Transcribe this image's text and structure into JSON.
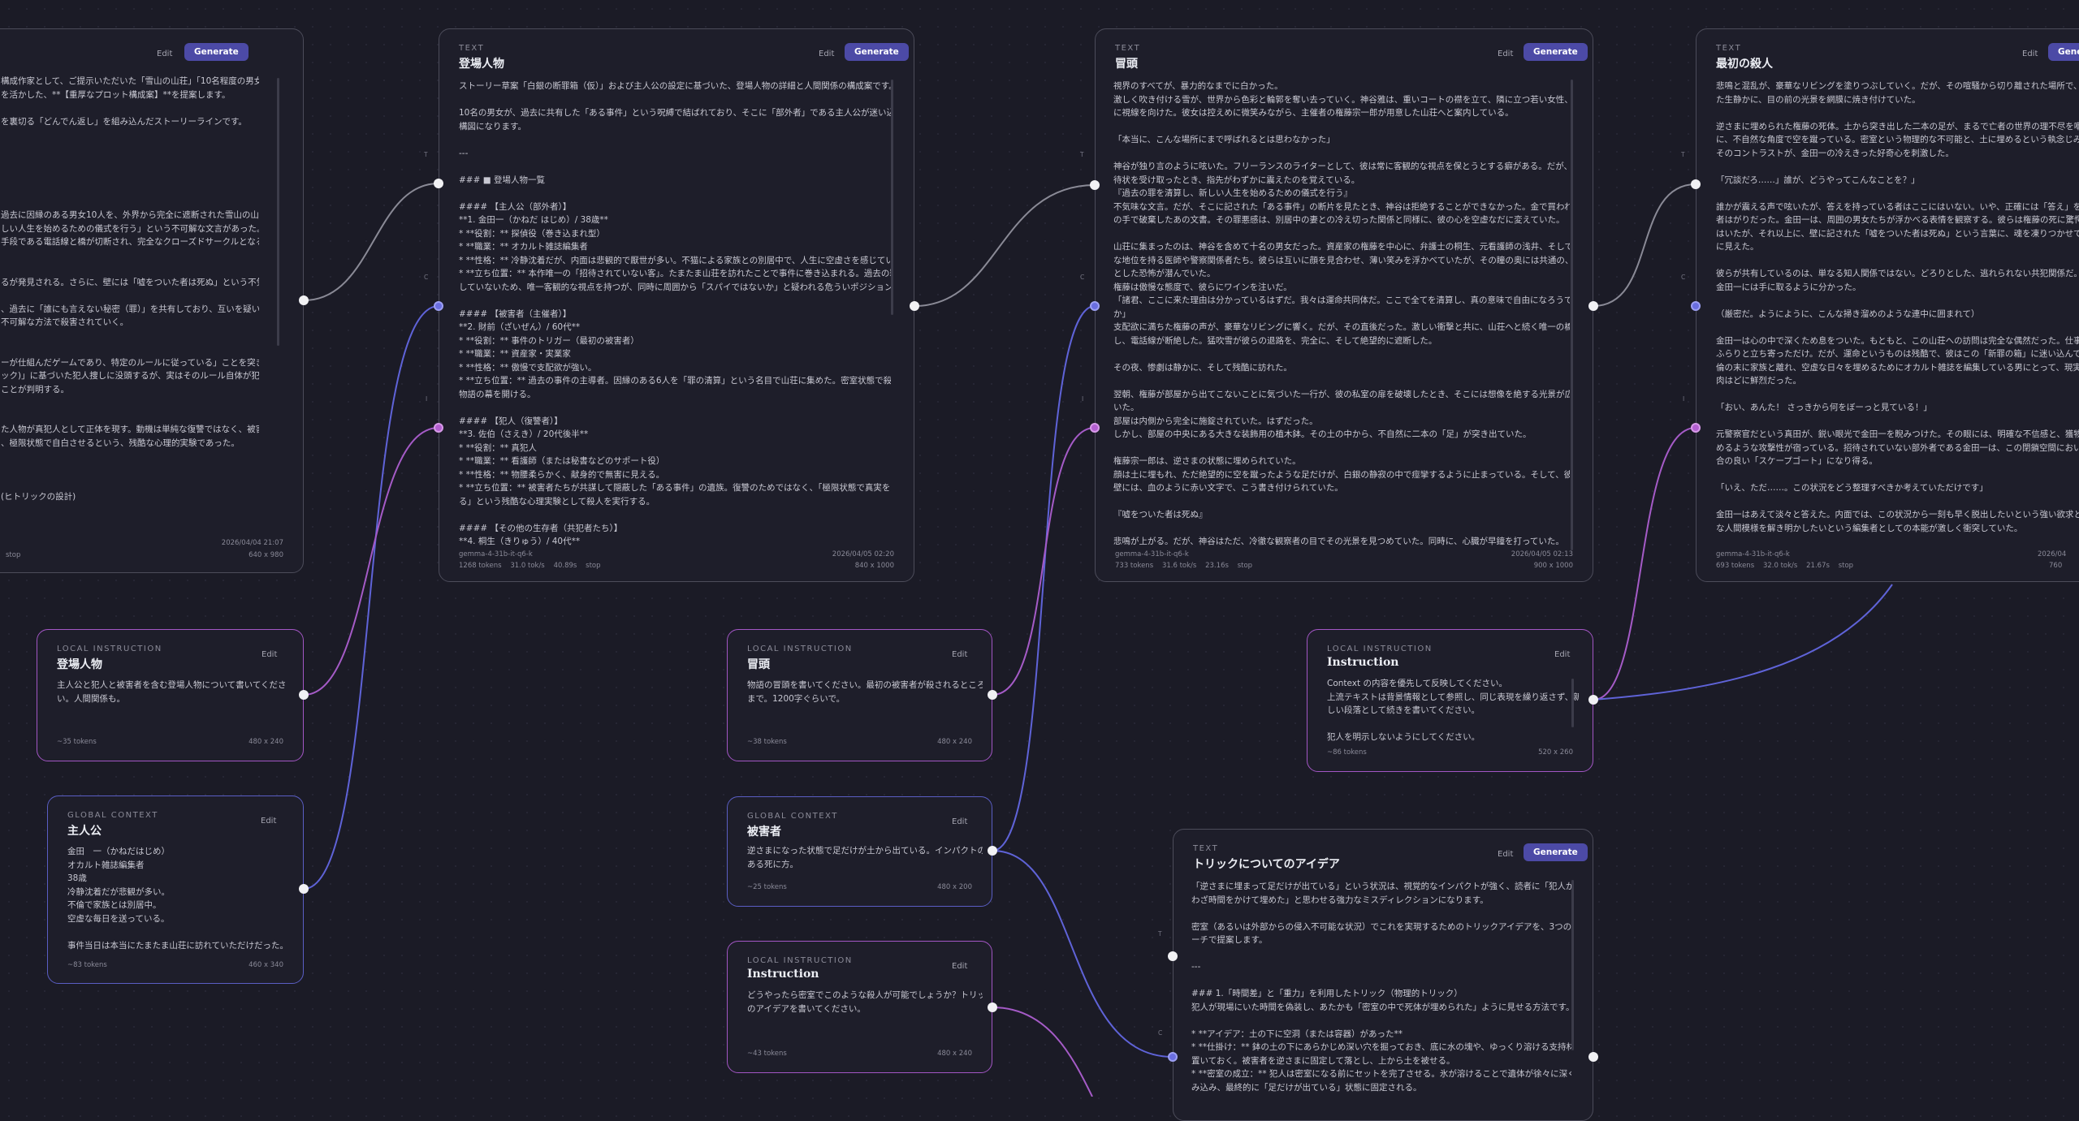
{
  "ui": {
    "edit_label": "Edit",
    "generate_label": "Generate"
  },
  "colors": {
    "background": "#1b1b26",
    "accent": "#4c4aa6",
    "local_border": "#a256c4",
    "global_border": "#5a5ec4",
    "wire_blue": "#5f63d8",
    "wire_purple": "#a55bc7",
    "wire_gray": "#8a8a96"
  },
  "cards": {
    "c1": {
      "kind": "",
      "title": "",
      "lines": [
        "構成作家として、ご提示いただいた「雪山の山荘」「10名程度の男女」という舌",
        "を活かした、**【重厚なプロット構成案】**を提案します。",
        "",
        "を裏切る「どんでん返し」を組み込んだストーリーラインです。",
        "",
        "",
        "",
        "",
        "",
        "",
        "過去に因縁のある男女10人を、外界から完全に遮断された雪山の山荘に招待す",
        "しい人生を始めるための儀式を行う」という不可解な文言があった。",
        "手段である電話線と橋が切断され、完全なクローズドサークルとなる。",
        "",
        "",
        "るが発見される。さらに、壁には「嘘をついた者は死ぬ」という不気味なメ",
        "",
        "、過去に「誰にも言えない秘密（罪）」を共有しており、互いを疑い合う。一",
        "不可解な方法で殺害されていく。",
        "",
        "",
        "ーが仕組んだゲームであり、特定のルールに従っている」ことを突き止める。",
        "ック)」に基づいた犯人捜しに没頭するが、実はそのルール自体が犯人によって",
        "ことが判明する。",
        "",
        "",
        "た人物が真犯人として正体を現す。動機は単純な復讐ではなく、被害者たちが",
        "、極限状態で自白させるという、残酷な心理的実験であった。",
        "",
        "",
        "",
        "(ヒトリックの設計)"
      ],
      "footer_date": "2026/04/04 21:07",
      "footer_stop": "stop",
      "footer_size": "640 x 980"
    },
    "c2": {
      "kind": "TEXT",
      "title": "登場人物",
      "lines": [
        "ストーリー草案「白銀の断罪箱（仮）」および主人公の設定に基づいた、登場人物の詳細と人間関係の構成案です。",
        "",
        "10名の男女が、過去に共有した「ある事件」という呪縛で結ばれており、そこに「部外者」である主人公が迷い込むという",
        "構図になります。",
        "",
        "---",
        "",
        "### ■ 登場人物一覧",
        "",
        "#### 【主人公（部外者）】",
        "**1. 金田一（かねだ はじめ）/ 38歳**",
        "* **役割：** 探偵役（巻き込まれ型）",
        "* **職業：** オカルト雑誌編集者",
        "* **性格：** 冷静沈着だが、内面は悲観的で厭世が多い。不猫による家族との別居中で、人生に空虚さを感じている。",
        "* **立ち位置：** 本作唯一の「招待されていない客」。たまたま山荘を訪れたことで事件に巻き込まれる。過去の罪を共有",
        "していないため、唯一客観的な視点を持つが、同時に周囲から「スパイではないか」と疑われる危ういポジションにいる。",
        "",
        "#### 【被害者（主催者）】",
        "**2. 財前（ざいぜん）/ 60代**",
        "* **役割：** 事件のトリガー（最初の被害者）",
        "* **職業：** 資産家・実業家",
        "* **性格：** 傲慢で支配欲が強い。",
        "* **立ち位置：** 過去の事件の主導者。因縁のある6人を「罪の清算」という名目で山荘に集めた。密室状態で殺害され、",
        "物語の幕を開ける。",
        "",
        "#### 【犯人（復讐者）】",
        "**3. 佐伯（さえき）/ 20代後半**",
        "* **役割：** 真犯人",
        "* **職業：** 看護師（または秘書などのサポート役）",
        "* **性格：** 物腰柔らかく、献身的で無害に見える。",
        "* **立ち位置：** 被害者たちが共謀して隠蔽した「ある事件」の遺族。復讐のためではなく、「極限状態で真実を自白させ",
        "る」という残酷な心理実験として殺人を実行する。",
        "",
        "#### 【その他の生存者（共犯者たち）】",
        "**4. 桐生（きりゅう）/ 40代**"
      ],
      "footer_model": "gemma-4-31b-it-q6-k",
      "footer_tokens": "1268 tokens",
      "footer_speed": "31.0 tok/s",
      "footer_time": "40.89s",
      "footer_stop": "stop",
      "footer_date": "2026/04/05 02:20",
      "footer_size": "840 x 1000"
    },
    "c3": {
      "kind": "TEXT",
      "title": "冒頭",
      "lines": [
        "視界のすべてが、暴力的なまでに白かった。",
        "激しく吹き付ける雪が、世界から色彩と輪郭を奪い去っていく。神谷雅は、重いコートの襟を立て、隣に立つ若い女性、佐伯舞",
        "に視線を向けた。彼女は控えめに微笑みながら、主催者の権藤宗一郎が用意した山荘へと案内している。",
        "",
        "「本当に、こんな場所にまで呼ばれるとは思わなかった」",
        "",
        "神谷が独り言のように呟いた。フリーランスのライターとして、彼は常に客観的な視点を保とうとする癖がある。だが、今回の招",
        "待状を受け取ったとき、指先がわずかに震えたのを覚えている。",
        "『過去の罪を清算し、新しい人生を始めるための儀式を行う』",
        "不気味な文言。だが、そこに記された「ある事件」の断片を見たとき、神谷は拒絶することができなかった。金で買われ、自ら",
        "の手で破棄したあの文書。その罪悪感は、別居中の妻との冷え切った関係と同様に、彼の心を空虚なだに変えていた。",
        "",
        "山荘に集まったのは、神谷を含めて十名の男女だった。資産家の権藤を中心に、弁護士の桐生、元看護師の浅井、そして社会的",
        "な地位を持る医師や警察関係者たち。彼らは互いに顔を見合わせ、薄い笑みを浮かべていたが、その瞳の奥には共通の、どろり",
        "とした恐怖が潜んでいた。",
        "権藤は傲慢な態度で、彼らにワインを注いだ。",
        "「諸君、ここに来た理由は分かっているはずだ。我々は運命共同体だ。ここで全てを清算し、真の意味で自由になろうではない",
        "か」",
        "支配欲に満ちた権藤の声が、豪華なリビングに響く。だが、その直後だった。激しい衝撃と共に、山荘へと続く唯一の橋が崩落",
        "し、電話線が断絶した。猛吹雪が彼らの退路を、完全に、そして絶望的に遮断した。",
        "",
        "その夜、惨劇は静かに、そして残酷に訪れた。",
        "",
        "翌朝、権藤が部屋から出てこないことに気づいた一行が、彼の私室の扉を破壊したとき、そこには想像を絶する光景が広がって",
        "いた。",
        "部屋は内側から完全に施錠されていた。はずだった。",
        "しかし、部屋の中央にある大きな装飾用の植木鉢。その土の中から、不自然に二本の「足」が突き出ていた。",
        "",
        "権藤宗一郎は、逆さまの状態に埋められていた。",
        "顔は土に埋もれ、ただ絶望的に空を蹴ったような足だけが、白銀の静寂の中で痙攣するように止まっている。そして、彼の傍らの",
        "壁には、血のように赤い文字で、こう書き付けられていた。",
        "",
        "『嘘をついた者は死ぬ』",
        "",
        "悲鳴が上がる。だが、神谷はただ、冷徹な観察者の目でその光景を見つめていた。同時に、心臓が早鐘を打っていた。"
      ],
      "footer_model": "gemma-4-31b-it-q6-k",
      "footer_tokens": "733 tokens",
      "footer_speed": "31.6 tok/s",
      "footer_time": "23.16s",
      "footer_stop": "stop",
      "footer_date": "2026/04/05 02:13",
      "footer_size": "900 x 1000"
    },
    "c4": {
      "kind": "TEXT",
      "title": "最初の殺人",
      "lines": [
        "悲鳴と混乱が、豪華なリビングを塗りつぶしていく。だが、その喧騒から切り離された場所で、金田一",
        "た生静かに、目の前の光景を網膜に焼き付けていた。",
        "",
        "逆さまに埋められた権藤の死体。土から突き出した二本の足が、まるで亡者の世界の理不尽を嘲笑うかのよう",
        "に、不自然な角度で空を蹴っている。密室という物理的な不可能と、土に埋めるという執念じみた殺意。",
        "そのコントラストが、金田一の冷えきった好奇心を刺激した。",
        "",
        "「冗談だろ……」誰が、どうやってこんなことを？」",
        "",
        "誰かが震える声で呟いたが、答えを持っている者はここにはいない。いや、正確には「答え」を知ってい",
        "者はがりだった。金田一は、周囲の男女たちが浮かべる表情を観察する。彼らは権藤の死に驚愕を覚えてい",
        "はいたが、それ以上に、壁に記された「嘘をついた者は死ぬ」という言葉に、魂を凍りつかせているよう",
        "に見えた。",
        "",
        "彼らが共有しているのは、単なる知人関係ではない。どろりとした、逃れられない共犯関係だ。それが、",
        "金田一には手に取るように分かった。",
        "",
        "（厳密だ。ようにように、こんな掃き溜めのような連中に囲まれて）",
        "",
        "金田一は心の中で深くため息をついた。もともと、この山荘への訪問は完全な偶然だった。仕事の企画",
        "ふらりと立ち寄っただけ。だが、運命というものは残酷で、彼はこの「新罪の箱」に迷い込んでしまった。",
        "倫の末に家族と離れ、空虚な日々を埋めるためにオカルト雑誌を編集している男にとって、現実の惨劇は",
        "肉はどに鮮烈だった。",
        "",
        "「おい、あんた！ さっきから何をぼーっと見ている！」",
        "",
        "元警察官だという真田が、鋭い眼光で金田一を睨みつけた。その眼には、明確な不信感と、獲物を追い込",
        "めるような攻撃性が宿っている。招待されていない部外者である金田一は、この閉鎖空間において、最も",
        "合の良い「スケープゴート」になり得る。",
        "",
        "「いえ、ただ……。この状況をどう整理すべきか考えていただけです」",
        "",
        "金田一はあえて淡々と答えた。内面では、この状況から一刻も早く脱出したいという強い欲求と、この謎",
        "な人間模様を解き明かしたいという編集者としての本能が激しく衝突していた。"
      ],
      "footer_model": "gemma-4-31b-it-q6-k",
      "footer_tokens": "693 tokens",
      "footer_speed": "32.0 tok/s",
      "footer_time": "21.67s",
      "footer_stop": "stop",
      "footer_date": "2026/04",
      "footer_size": "760"
    },
    "c5": {
      "kind": "LOCAL INSTRUCTION",
      "title": "登場人物",
      "lines": [
        "主人公と犯人と被害者を含む登場人物について書いてくださ",
        "い。人間関係も。"
      ],
      "footer_tokens": "~35 tokens",
      "footer_size": "480 x 240"
    },
    "c6": {
      "kind": "GLOBAL CONTEXT",
      "title": "主人公",
      "lines": [
        "金田　一（かねだはじめ）",
        "オカルト雑誌編集者",
        "38歳",
        "冷静沈着だが悲観が多い。",
        "不倫で家族とは別居中。",
        "空虚な毎日を送っている。",
        "",
        "事件当日は本当にたまたま山荘に訪れていただけだった。"
      ],
      "footer_tokens": "~83 tokens",
      "footer_size": "460 x 340"
    },
    "c7": {
      "kind": "LOCAL INSTRUCTION",
      "title": "冒頭",
      "lines": [
        "物語の冒頭を書いてください。最初の被害者が殺されるところ",
        "まで。1200字ぐらいで。"
      ],
      "footer_tokens": "~38 tokens",
      "footer_size": "480 x 240"
    },
    "c8": {
      "kind": "GLOBAL CONTEXT",
      "title": "被害者",
      "lines": [
        "逆さまになった状態で足だけが土から出ている。インパクトの",
        "ある死に方。"
      ],
      "footer_tokens": "~25 tokens",
      "footer_size": "480 x 200"
    },
    "c9": {
      "kind": "LOCAL INSTRUCTION",
      "title": "Instruction",
      "lines": [
        "どうやったら密室でこのような殺人が可能でしょうか？トリック",
        "のアイデアを書いてください。"
      ],
      "footer_tokens": "~43 tokens",
      "footer_size": "480 x 240"
    },
    "c10": {
      "kind": "LOCAL INSTRUCTION",
      "title": "Instruction",
      "lines": [
        "Context の内容を優先して反映してください。",
        "上流テキストは背景情報として参照し、同じ表現を繰り返さず、新",
        "しい段落として続きを書いてください。",
        "",
        "犯人を明示しないようにしてください。"
      ],
      "footer_tokens": "~86 tokens",
      "footer_size": "520 x 260"
    },
    "c11": {
      "kind": "TEXT",
      "title": "トリックについてのアイデア",
      "lines": [
        "「逆さまに埋まって足だけが出ている」という状況は、視覚的なインパクトが強く、読者に「犯人がわざ",
        "わざ時間をかけて埋めた」と思わせる強力なミスディレクションになります。",
        "",
        "密室（あるいは外部からの侵入不可能な状況）でこれを実現するためのトリックアイデアを、3つのアプロ",
        "ーチで提案します。",
        "",
        "---",
        "",
        "### 1.「時間差」と「重力」を利用したトリック（物理的トリック）",
        "犯人が現場にいた時間を偽装し、あたかも「密室の中で死体が埋められた」ように見せる方法です。",
        "",
        "* **アイデア：土の下に空洞（または容器）があった**",
        "  * **仕掛け：** 鉢の土の下にあらかじめ深い穴を掘っておき、底に水の塊や、ゆっくり溶ける支持材を",
        "置いておく。被害者を逆さまに固定して落とし、上から土を被せる。",
        "  * **密室の成立：** 犯人は密室になる前にセットを完了させる。氷が溶けることで遺体が徐々に深く沈",
        "み込み、最終的に「足だけが出ている」状態に固定される。"
      ],
      "footer_tokens": "",
      "footer_size": ""
    }
  }
}
